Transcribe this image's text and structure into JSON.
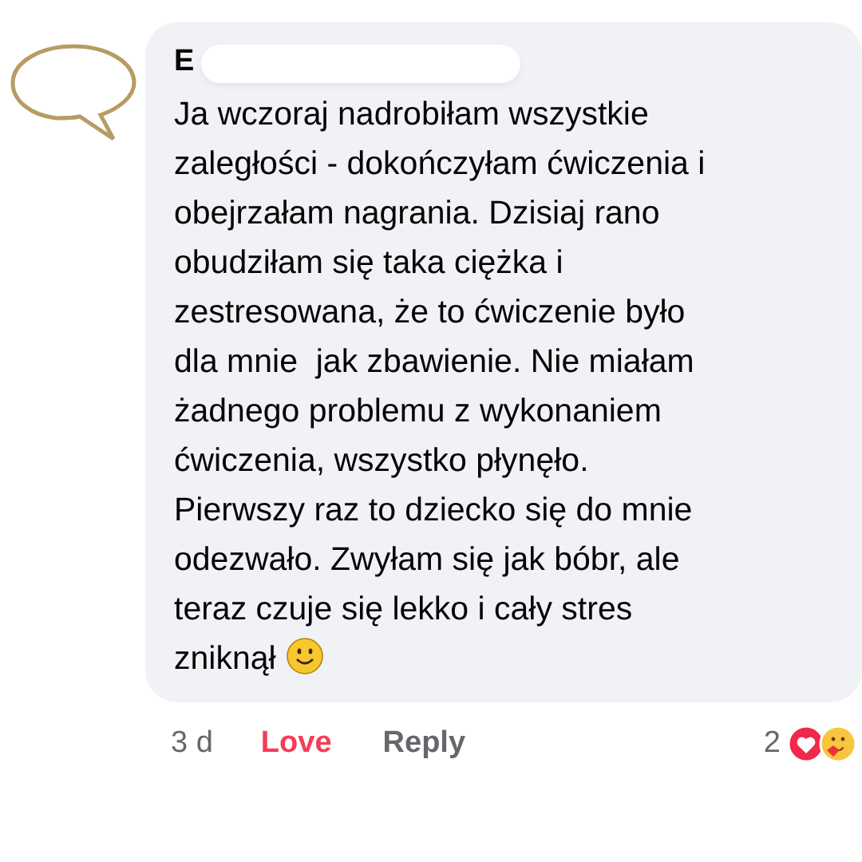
{
  "comment": {
    "author": "E",
    "author_redacted": true,
    "lines": [
      "Ja wczoraj nadrobiłam wszystkie",
      "zaległości - dokończyłam ćwiczenia i",
      "obejrzałam nagrania. Dzisiaj rano",
      "obudziłam się taka ciężka i",
      "zestresowana, że to ćwiczenie było",
      "dla mnie  jak zbawienie. Nie miałam",
      "żadnego problemu z wykonaniem",
      "ćwiczenia, wszystko płynęło.",
      "Pierwszy raz to dziecko się do mnie",
      "odezwało. Zwyłam się jak bóbr, ale",
      "teraz czuje się lekko i cały stres",
      "zniknął"
    ]
  },
  "footer": {
    "time": "3 d",
    "actions": [
      {
        "label": "Love",
        "selected": true
      },
      {
        "label": "Reply",
        "selected": false
      }
    ],
    "reaction_count": "2"
  }
}
